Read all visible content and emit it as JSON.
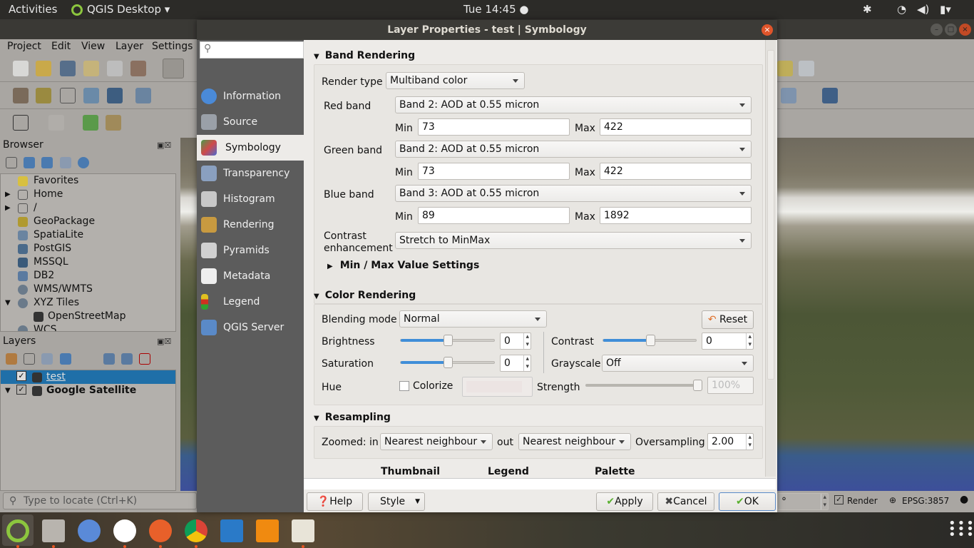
{
  "topbar": {
    "activities": "Activities",
    "app": "QGIS Desktop ▾",
    "clock": "Tue 14:45 ●"
  },
  "qgis": {
    "menu": [
      "Project",
      "Edit",
      "View",
      "Layer",
      "Settings"
    ],
    "browser": {
      "title": "Browser",
      "items": [
        "Favorites",
        "Home",
        "/",
        "GeoPackage",
        "SpatiaLite",
        "PostGIS",
        "MSSQL",
        "DB2",
        "WMS/WMTS",
        "XYZ Tiles",
        "OpenStreetMap",
        "WCS"
      ]
    },
    "layers": {
      "title": "Layers",
      "items": [
        "test",
        "Google Satellite"
      ]
    },
    "locate_placeholder": "Type to locate (Ctrl+K)",
    "status": {
      "rotation": "°",
      "render": "Render",
      "crs": "EPSG:3857"
    }
  },
  "dialog": {
    "title": "Layer Properties - test | Symbology",
    "sidebar": [
      "Information",
      "Source",
      "Symbology",
      "Transparency",
      "Histogram",
      "Rendering",
      "Pyramids",
      "Metadata",
      "Legend",
      "QGIS Server"
    ],
    "selected": "Symbology",
    "band_rendering": {
      "title": "Band Rendering",
      "render_type_label": "Render type",
      "render_type": "Multiband color",
      "bands": [
        {
          "label": "Red band",
          "value": "Band 2: AOD at 0.55 micron",
          "min": "73",
          "max": "422"
        },
        {
          "label": "Green band",
          "value": "Band 2: AOD at 0.55 micron",
          "min": "73",
          "max": "422"
        },
        {
          "label": "Blue band",
          "value": "Band 3: AOD at 0.55 micron",
          "min": "89",
          "max": "1892"
        }
      ],
      "min_label": "Min",
      "max_label": "Max",
      "contrast_label_1": "Contrast",
      "contrast_label_2": "enhancement",
      "contrast": "Stretch to MinMax",
      "minmax_settings": "Min / Max Value Settings"
    },
    "color_rendering": {
      "title": "Color Rendering",
      "blending_label": "Blending mode",
      "blending": "Normal",
      "reset": "Reset",
      "brightness_label": "Brightness",
      "brightness": "0",
      "contrast_label": "Contrast",
      "contrast": "0",
      "saturation_label": "Saturation",
      "saturation": "0",
      "grayscale_label": "Grayscale",
      "grayscale": "Off",
      "hue_label": "Hue",
      "colorize": "Colorize",
      "strength_label": "Strength",
      "strength": "100%"
    },
    "resampling": {
      "title": "Resampling",
      "zoomed_in_label": "Zoomed: in",
      "zoomed_in": "Nearest neighbour",
      "out_label": "out",
      "zoomed_out": "Nearest neighbour",
      "oversampling_label": "Oversampling",
      "oversampling": "2.00"
    },
    "preview_headers": [
      "Thumbnail",
      "Legend",
      "Palette"
    ],
    "buttons": {
      "help": "Help",
      "style": "Style",
      "apply": "Apply",
      "cancel": "Cancel",
      "ok": "OK"
    }
  },
  "colors": {
    "accent": "#3f8ed8",
    "selection": "#1f6fa8",
    "close": "#e0552b"
  }
}
